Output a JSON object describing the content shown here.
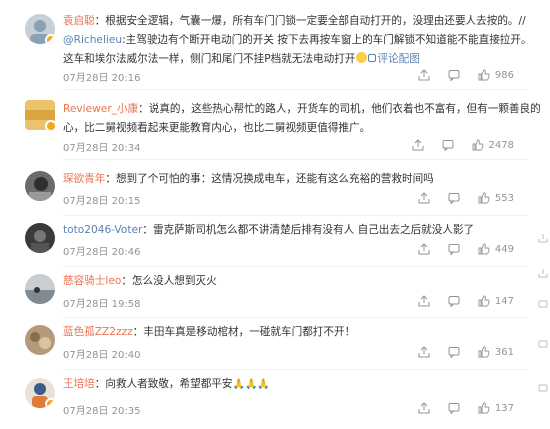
{
  "comments": [
    {
      "user": "袁启聪",
      "verified": true,
      "avatar_color": "#c9cfd6",
      "text_before": "：根据安全逻辑，气囊一爆，所有车门门锁一定要全部自动打开的，没理由还要人去按的。//",
      "mention": "@Richelieu",
      "text_after_line2": ":主驾驶边有个断开电动门的开关 按下去再按车窗上的车门解锁不知道能不能直接拉开。",
      "text_line3": "这车和埃尔法威尔法一样，侧门和尾门不挂P档就无法电动打开",
      "link_text": "评论配图",
      "date": "07月28日 20:16",
      "likes": "986"
    },
    {
      "user": "Reviewer_小康",
      "verified": true,
      "avatar_color": "#e9c46a",
      "text_line1": "：说真的，这些热心帮忙的路人，开货车的司机，他们衣着也不富有，但有一颗善良的",
      "text_line2": "心，比二舅视频看起来更能教育内心，也比二舅视频更值得推广。",
      "date": "07月28日 20:34",
      "likes": "2478"
    },
    {
      "user": "琛欲青年",
      "verified": false,
      "avatar_color": "#6b6b6b",
      "text_line1": "：想到了个可怕的事：这情况换成电车，还能有这么充裕的营救时间吗",
      "date": "07月28日 20:15",
      "likes": "553"
    },
    {
      "user": "toto2046-Voter",
      "verified": false,
      "avatar_color": "#3a3a3a",
      "text_line1": "：雷克萨斯司机怎么都不讲清楚后排有没有人 自己出去之后就没人影了",
      "date": "07月28日 20:46",
      "likes": "449"
    },
    {
      "user": "慈容骑士leo",
      "verified": false,
      "avatar_color": "#9aa3ab",
      "text_line1": "：怎么没人想到灭火",
      "date": "07月28日 19:58",
      "likes": "147"
    },
    {
      "user": "蓝色孤ZZ2zzz",
      "verified": false,
      "avatar_color": "#b49a7a",
      "text_line1": "：丰田车真是移动棺材，一碰就车门都打不开！",
      "date": "07月28日 20:40",
      "likes": "361"
    },
    {
      "user": "王培培",
      "verified": true,
      "avatar_color": "#e8e1d6",
      "text_line1": "：向救人者致敬，希望都平安",
      "date": "07月28日 20:35",
      "likes": "137"
    }
  ]
}
